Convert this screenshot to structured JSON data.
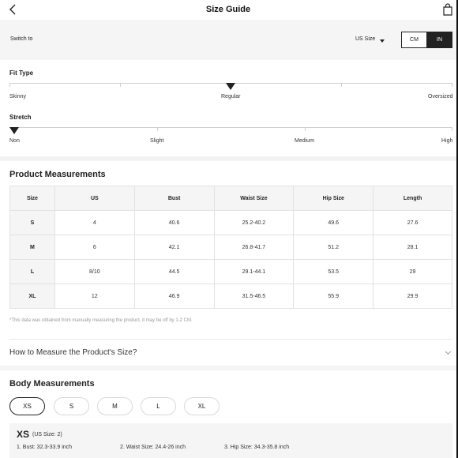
{
  "header": {
    "title": "Size Guide"
  },
  "switch": {
    "label": "Switch to",
    "size_system": "US Size",
    "units": [
      "CM",
      "IN"
    ],
    "selected_unit": "IN"
  },
  "fit": {
    "label": "Fit Type",
    "options": [
      "Skinny",
      "Regular",
      "Oversized"
    ],
    "selected": "Regular"
  },
  "stretch": {
    "label": "Stretch",
    "options": [
      "Non",
      "Slight",
      "Medium",
      "High"
    ],
    "selected": "Non"
  },
  "product": {
    "title": "Product Measurements",
    "headers": [
      "Size",
      "US",
      "Bust",
      "Waist Size",
      "Hip Size",
      "Length"
    ],
    "rows": [
      [
        "S",
        "4",
        "40.6",
        "25.2-40.2",
        "49.6",
        "27.6"
      ],
      [
        "M",
        "6",
        "42.1",
        "26.8-41.7",
        "51.2",
        "28.1"
      ],
      [
        "L",
        "8/10",
        "44.5",
        "29.1-44.1",
        "53.5",
        "29"
      ],
      [
        "XL",
        "12",
        "46.9",
        "31.5-46.5",
        "55.9",
        "29.9"
      ]
    ],
    "note": "*This data was obtained from manually measuring the product, it may be off by 1-2 CM."
  },
  "howto": {
    "label": "How to Measure the Product's Size?"
  },
  "body": {
    "title": "Body Measurements",
    "sizes": [
      "XS",
      "S",
      "M",
      "L",
      "XL"
    ],
    "selected": "XS",
    "detail": {
      "size": "XS",
      "us_size": "(US Size: 2)",
      "values": [
        "1. Bust: 32.3-33.9 inch",
        "2. Waist Size: 24.4-26 inch",
        "3. Hip Size: 34.3-35.8 inch"
      ]
    }
  }
}
